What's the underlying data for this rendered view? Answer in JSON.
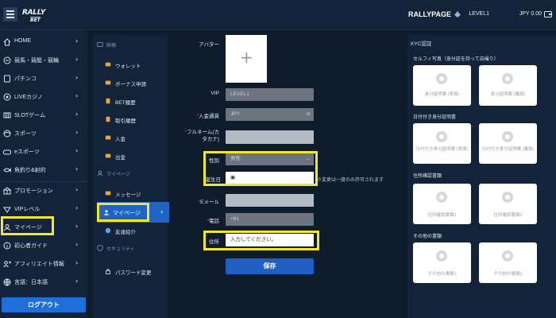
{
  "brand": {
    "logo_top": "RALLY",
    "logo_bottom": "BET",
    "name": "RALLYPAGE"
  },
  "user": {
    "level": "LEVEL1",
    "balance": "JPY 0.00"
  },
  "sidebar": {
    "items": [
      {
        "label": "HOME",
        "icon": "home-icon"
      },
      {
        "label": "競馬・競艇・競輪",
        "icon": "racing-icon"
      },
      {
        "label": "パチンコ",
        "icon": "pachinko-icon"
      },
      {
        "label": "LIVEカジノ",
        "icon": "live-casino-icon"
      },
      {
        "label": "SLOTゲーム",
        "icon": "slot-icon"
      },
      {
        "label": "スポーツ",
        "icon": "sports-icon"
      },
      {
        "label": "eスポーツ",
        "icon": "esports-icon"
      },
      {
        "label": "魚釣り&射的",
        "icon": "fishing-icon"
      },
      {
        "label": "プロモーション",
        "icon": "promotion-icon"
      },
      {
        "label": "VIPレベル",
        "icon": "vip-icon"
      },
      {
        "label": "マイページ",
        "icon": "mypage-icon"
      },
      {
        "label": "初心者ガイド",
        "icon": "guide-icon"
      },
      {
        "label": "アフィリエイト情報",
        "icon": "affiliate-icon"
      },
      {
        "label": "言語：日本語",
        "icon": "language-icon"
      }
    ],
    "logout_label": "ログアウト"
  },
  "submenu": {
    "finance_title": "財務",
    "finance_items": [
      "ウォレット",
      "ボーナス申請",
      "BET履歴",
      "取引履歴",
      "入金",
      "出金"
    ],
    "mypage_title": "マイページ",
    "mypage_items": [
      "メッセージ",
      "マイページ",
      "友達紹介"
    ],
    "security_title": "セキュリティ",
    "security_items": [
      "パスワード変更"
    ]
  },
  "form": {
    "avatar_label": "アバター",
    "vip_label": "VIP",
    "vip_value": "LEVEL1",
    "currency_label": "入金通貨",
    "currency_value": "JPY",
    "fullname_label_1": "フルネーム(カ",
    "fullname_label_2": "タカナ)",
    "gender_label": "性別",
    "gender_value": "男性",
    "birthday_label": "誕生日",
    "gender_note": "※変更は一度のみ許可されます",
    "email_label": "Eメール",
    "phone_label": "電話",
    "phone_prefix": "+81",
    "address_label": "住所",
    "address_placeholder": "入力してください。",
    "save_label": "保存"
  },
  "kyc": {
    "title": "KYC認証",
    "selfie_title": "セルフィ写真（身分証を持って自撮り）",
    "selfie_cards": [
      "身分証明書 (表面)",
      "身分証明書 (裏面)"
    ],
    "dated_title": "日付付き身分証明書",
    "dated_cards": [
      "日付付き身分証明書 (表面)",
      "日付付き身分証明書 (裏面)"
    ],
    "address_title": "住所確認書類",
    "address_cards": [
      "住所確認書類1",
      "住所確認書類2"
    ],
    "other_title": "その他の書類",
    "other_cards": [
      "その他の書類1",
      "その他の書類2"
    ]
  },
  "colors": {
    "highlight": "#f2e632",
    "accent": "#1f63c4",
    "required": "#e04444"
  }
}
